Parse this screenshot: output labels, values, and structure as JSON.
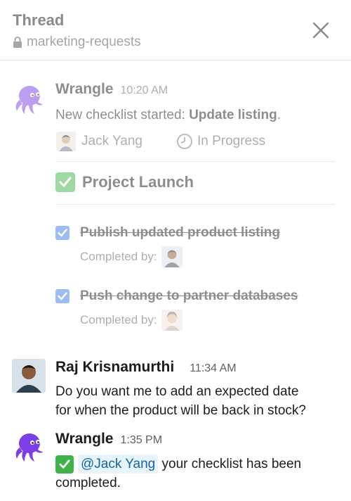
{
  "header": {
    "title": "Thread",
    "channel": "marketing-requests"
  },
  "thread_message": {
    "author": "Wrangle",
    "time": "10:20 AM",
    "text_prefix": "New checklist started: ",
    "text_bold": "Update listing",
    "text_suffix": ".",
    "assignee": "Jack Yang",
    "status": "In Progress",
    "checklist_title": "Project Launch",
    "items": [
      {
        "label": "Publish updated product listing",
        "completed_by_label": "Completed by:"
      },
      {
        "label": "Push change to partner databases",
        "completed_by_label": "Completed by:"
      }
    ]
  },
  "messages": [
    {
      "author": "Raj Krisnamurthi",
      "time": "11:34 AM",
      "text_line1": "Do you want me to add an expected date",
      "text_line2": "for when the product will be back in stock?"
    },
    {
      "author": "Wrangle",
      "time": "1:35 PM",
      "mention": "@Jack Yang",
      "text_after_mention": " your checklist has been",
      "text_line2": "completed."
    }
  ],
  "colors": {
    "wrangle_purple": "#7b3fe4",
    "checkbox_blue": "#3b7ee8",
    "check_green": "#3fb24a",
    "mention_bg": "#e8f4fb",
    "mention_text": "#1264a3"
  }
}
